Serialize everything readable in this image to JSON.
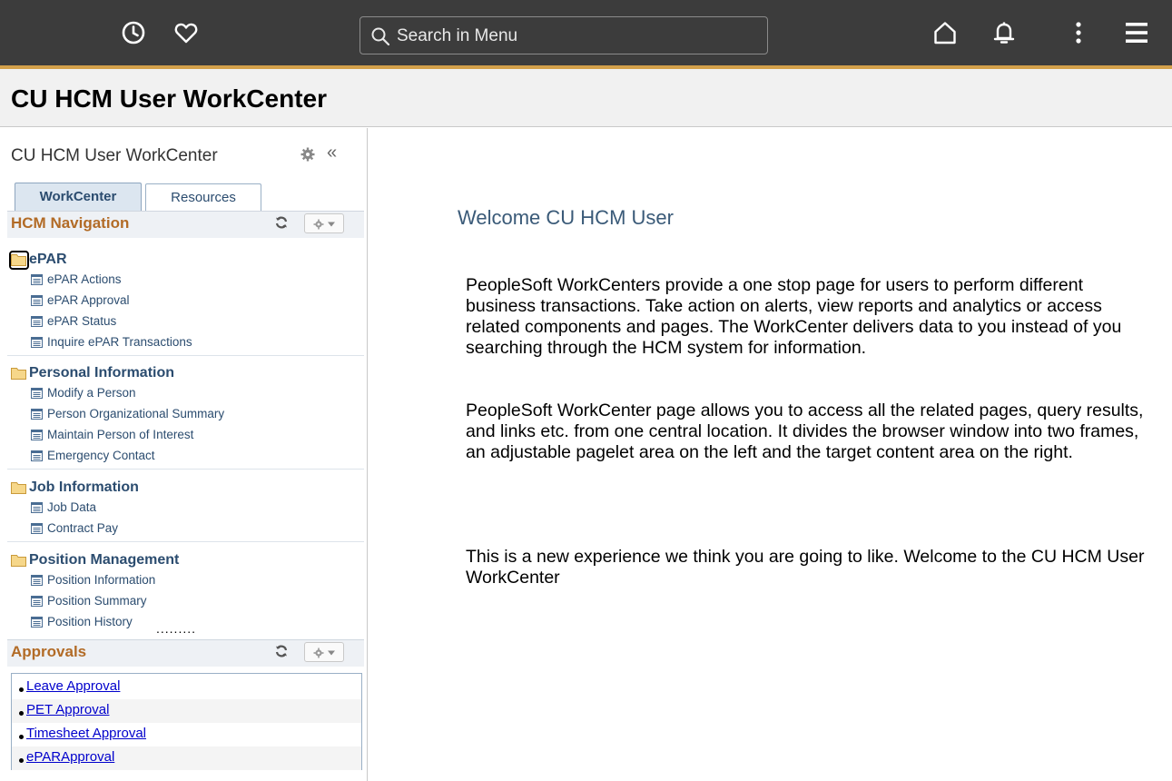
{
  "topbar": {
    "icons": [
      "recent-clock-icon",
      "favorites-heart-icon",
      "home-icon",
      "bell-icon",
      "more-vertical-icon",
      "menu-hamburger-icon"
    ],
    "search_placeholder": "Search in Menu",
    "accent_color": "#d3a04a",
    "bar_color": "#3c3c3c"
  },
  "page": {
    "title": "CU HCM User WorkCenter"
  },
  "pagelet": {
    "title": "CU HCM User WorkCenter",
    "tabs": [
      {
        "label": "WorkCenter",
        "active": true
      },
      {
        "label": "Resources",
        "active": false
      }
    ],
    "navigation": {
      "header": "HCM Navigation",
      "groups": [
        {
          "label": "ePAR",
          "items": [
            "ePAR Actions",
            "ePAR Approval",
            "ePAR Status",
            "Inquire ePAR Transactions"
          ]
        },
        {
          "label": "Personal Information",
          "items": [
            "Modify a Person",
            "Person Organizational Summary",
            "Maintain Person of Interest",
            "Emergency Contact"
          ]
        },
        {
          "label": "Job Information",
          "items": [
            "Job Data",
            "Contract Pay"
          ]
        },
        {
          "label": "Position Management",
          "items": [
            "Position Information",
            "Position Summary",
            "Position History"
          ]
        }
      ]
    },
    "approvals": {
      "header": "Approvals",
      "links": [
        "Leave Approval",
        "PET Approval",
        "Timesheet Approval",
        "ePARApproval"
      ]
    }
  },
  "main": {
    "welcome": "Welcome CU HCM User",
    "paragraphs": [
      "PeopleSoft WorkCenters provide a one stop page for users to perform different business transactions. Take action on alerts, view reports and analytics or access related components and pages. The WorkCenter delivers data to you instead of you searching through the HCM system for information.",
      "PeopleSoft WorkCenter page allows you to access all the related pages, query results, and links etc. from one central location. It divides the browser window into two frames, an adjustable pagelet area on the left and the target content area on the right.",
      "This is a new experience we think you are going to like. Welcome to the CU HCM User WorkCenter"
    ]
  },
  "colors": {
    "header_label": "#b26b26",
    "nav_text": "#2b4c6f",
    "link": "#0000cc",
    "welcome": "#3a5a78"
  }
}
